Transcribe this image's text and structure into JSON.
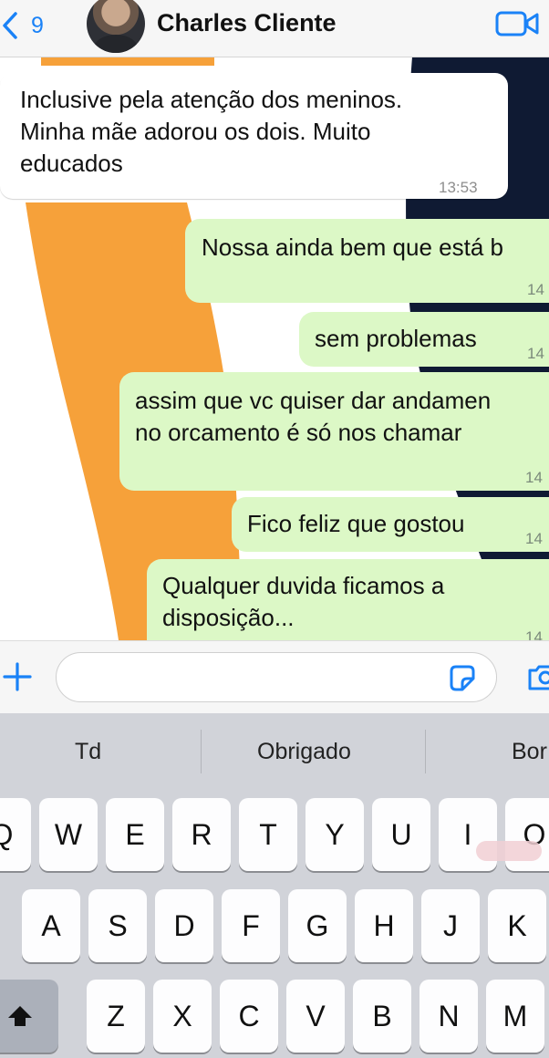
{
  "header": {
    "back_count": "9",
    "contact_name": "Charles Cliente"
  },
  "messages": [
    {
      "dir": "in",
      "lines": [
        "Inclusive pela atenção dos meninos.",
        "Minha mãe adorou os dois. Muito",
        "educados"
      ],
      "time": "13:53"
    },
    {
      "dir": "out",
      "lines": [
        "Nossa ainda bem que está b"
      ],
      "time": "14"
    },
    {
      "dir": "out",
      "lines": [
        "sem problemas"
      ],
      "time": "14"
    },
    {
      "dir": "out",
      "lines": [
        "assim que vc quiser dar andamen",
        "no orcamento é só nos chamar"
      ],
      "time": "14"
    },
    {
      "dir": "out",
      "lines": [
        "Fico feliz que gostou"
      ],
      "time": "14"
    },
    {
      "dir": "out",
      "lines": [
        "Qualquer duvida ficamos a",
        "disposição..."
      ],
      "time": "14"
    }
  ],
  "input": {
    "value": ""
  },
  "keyboard": {
    "suggestions": [
      "Td",
      "Obrigado",
      "Bor"
    ],
    "row1": [
      "Q",
      "W",
      "E",
      "R",
      "T",
      "Y",
      "U",
      "I",
      "O"
    ],
    "row2": [
      "A",
      "S",
      "D",
      "F",
      "G",
      "H",
      "J",
      "K"
    ],
    "row3": [
      "Z",
      "X",
      "C",
      "V",
      "B",
      "N",
      "M"
    ]
  },
  "colors": {
    "accent": "#1a82f7",
    "outgoing_bubble": "#dcf8c6",
    "wallpaper_orange": "#f6a13a",
    "wallpaper_navy": "#0f1a33"
  },
  "icons": [
    "chevron-left-icon",
    "video-call-icon",
    "plus-icon",
    "sticker-icon",
    "camera-icon",
    "shift-icon"
  ]
}
